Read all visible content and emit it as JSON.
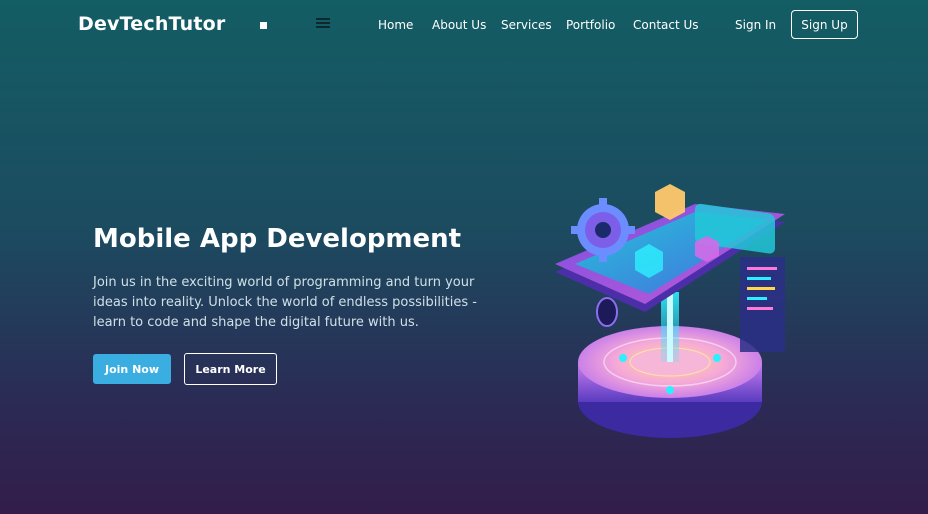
{
  "nav": {
    "brand": "DevTechTutor",
    "links": [
      "Home",
      "About Us",
      "Services",
      "Portfolio",
      "Contact Us"
    ],
    "sign_in": "Sign In",
    "sign_up": "Sign Up",
    "icons": {
      "square": "square-icon",
      "menu": "menu-icon"
    }
  },
  "hero": {
    "title": "Mobile App Development",
    "description": "Join us in the exciting world of programming and turn your ideas into reality. Unlock the world of endless possibilities - learn to code and shape the digital future with us.",
    "join_label": "Join Now",
    "learn_label": "Learn More"
  },
  "colors": {
    "accent": "#3aaee0",
    "bg_top": "#135d64",
    "bg_bottom": "#331d4a"
  }
}
